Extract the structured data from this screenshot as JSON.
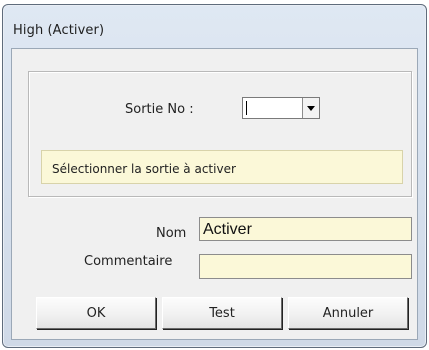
{
  "window": {
    "title": "High (Activer)"
  },
  "form": {
    "output_label": "Sortie No :",
    "output_select_value": "",
    "hint": "Sélectionner la sortie à activer",
    "name_label": "Nom",
    "name_value": "Activer",
    "comment_label": "Commentaire",
    "comment_value": ""
  },
  "buttons": {
    "ok_label": "OK",
    "test_label": "Test",
    "cancel_label": "Annuler"
  },
  "icons": {
    "dropdown": "chevron-down-icon"
  },
  "colors": {
    "input_background": "#fbf8d8",
    "window_frame": "#d7e1ee",
    "dialog_background": "#f0f0f0"
  }
}
